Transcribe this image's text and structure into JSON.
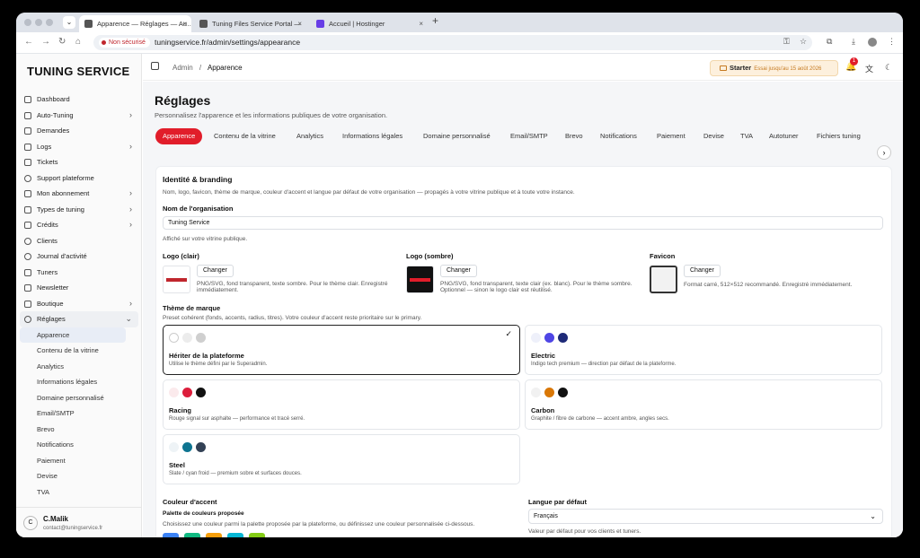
{
  "browser": {
    "tabs": [
      {
        "label": "Apparence — Réglages — Au…"
      },
      {
        "label": "Tuning Files Service Portal —"
      },
      {
        "label": "Accueil | Hostinger"
      }
    ],
    "insecure": "Non sécurisé",
    "url": "tuningservice.fr/admin/settings/appearance"
  },
  "sidebar": {
    "brand": "TUNING SERVICE",
    "items": [
      {
        "label": "Dashboard"
      },
      {
        "label": "Auto-Tuning",
        "chev": "›"
      },
      {
        "label": "Demandes"
      },
      {
        "label": "Logs",
        "chev": "›"
      },
      {
        "label": "Tickets"
      },
      {
        "label": "Support plateforme"
      },
      {
        "label": "Mon abonnement",
        "chev": "›"
      },
      {
        "label": "Types de tuning",
        "chev": "›"
      },
      {
        "label": "Crédits",
        "chev": "›"
      },
      {
        "label": "Clients"
      },
      {
        "label": "Journal d'activité"
      },
      {
        "label": "Tuners"
      },
      {
        "label": "Newsletter"
      },
      {
        "label": "Boutique",
        "chev": "›"
      },
      {
        "label": "Réglages",
        "chev": "⌄"
      }
    ],
    "subitems": [
      {
        "label": "Apparence"
      },
      {
        "label": "Contenu de la vitrine"
      },
      {
        "label": "Analytics"
      },
      {
        "label": "Informations légales"
      },
      {
        "label": "Domaine personnalisé"
      },
      {
        "label": "Email/SMTP"
      },
      {
        "label": "Brevo"
      },
      {
        "label": "Notifications"
      },
      {
        "label": "Paiement"
      },
      {
        "label": "Devise"
      },
      {
        "label": "TVA"
      }
    ],
    "user": {
      "initial": "C",
      "name": "C.Malik",
      "email": "contact@tuningservice.fr"
    }
  },
  "topbar": {
    "crumb_root": "Admin",
    "crumb_sep": "/",
    "crumb_current": "Apparence",
    "plan": "Starter",
    "trial": "Essai jusqu'au 15 août 2026",
    "notif_count": "1"
  },
  "page": {
    "title": "Réglages",
    "subtitle": "Personnalisez l'apparence et les informations publiques de votre organisation.",
    "tabs": [
      {
        "label": "Apparence"
      },
      {
        "label": "Contenu de la vitrine"
      },
      {
        "label": "Analytics"
      },
      {
        "label": "Informations légales"
      },
      {
        "label": "Domaine personnalisé"
      },
      {
        "label": "Email/SMTP"
      },
      {
        "label": "Brevo"
      },
      {
        "label": "Notifications"
      },
      {
        "label": "Paiement"
      },
      {
        "label": "Devise"
      },
      {
        "label": "TVA"
      },
      {
        "label": "Autotuner"
      },
      {
        "label": "Fichiers tuning"
      }
    ]
  },
  "identity": {
    "title": "Identité & branding",
    "desc": "Nom, logo, favicon, thème de marque, couleur d'accent et langue par défaut de votre organisation — propagés à votre vitrine publique et à toute votre instance.",
    "org_label": "Nom de l'organisation",
    "org_value": "Tuning Service",
    "org_hint": "Affiché sur votre vitrine publique.",
    "logo_light_label": "Logo (clair)",
    "logo_dark_label": "Logo (sombre)",
    "favicon_label": "Favicon",
    "change": "Changer",
    "logo_light_desc": "PNG/SVG, fond transparent, texte sombre. Pour le thème clair. Enregistré immédiatement.",
    "logo_dark_desc": "PNG/SVG, fond transparent, texte clair (ex. blanc). Pour le thème sombre. Optionnel — sinon le logo clair est réutilisé.",
    "favicon_desc": "Format carré, 512×512 recommandé. Enregistré immédiatement."
  },
  "themes": {
    "title": "Thème de marque",
    "desc": "Preset cohérent (fonds, accents, radius, titres). Votre couleur d'accent reste prioritaire sur le primary.",
    "check": "✓",
    "items": [
      {
        "name": "Hériter de la plateforme",
        "desc": "Utilise le thème défini par le Superadmin.",
        "colors": [
          "#ffffff",
          "#ececec",
          "#cfcfcf"
        ]
      },
      {
        "name": "Electric",
        "desc": "Indigo tech premium — direction par défaut de la plateforme.",
        "colors": [
          "#eef0fa",
          "#4f46e5",
          "#1e2a78"
        ]
      },
      {
        "name": "Racing",
        "desc": "Rouge signal sur asphalte — performance et tracé serré.",
        "colors": [
          "#fbeaec",
          "#dc1e3c",
          "#111111"
        ]
      },
      {
        "name": "Carbon",
        "desc": "Graphite / fibre de carbone — accent ambre, angles secs.",
        "colors": [
          "#f1f1f1",
          "#d97706",
          "#111111"
        ]
      },
      {
        "name": "Steel",
        "desc": "Slate / cyan froid — premium sobre et surfaces douces.",
        "colors": [
          "#eef3f6",
          "#0e7490",
          "#334155"
        ]
      }
    ]
  },
  "accent": {
    "title": "Couleur d'accent",
    "palette_label": "Palette de couleurs proposée",
    "palette_desc": "Choisissez une couleur parmi la palette proposée par la plateforme, ou définissez une couleur personnalisée ci-dessous.",
    "chips": [
      "#3b82f6",
      "#10b981",
      "#f59e0b",
      "#06b6d4",
      "#84cc16"
    ]
  },
  "language": {
    "title": "Langue par défaut",
    "value": "Français",
    "hint": "Valeur par défaut pour vos clients et tuners."
  }
}
